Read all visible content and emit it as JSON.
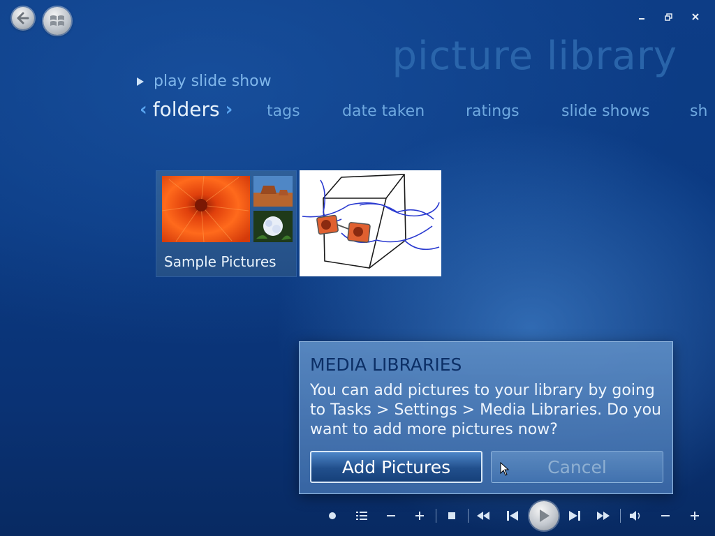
{
  "window": {
    "title": "picture library",
    "controls": {
      "minimize_icon": "minimize-icon",
      "restore_icon": "restore-icon",
      "close_icon": "close-icon"
    }
  },
  "nav": {
    "back_icon": "back-arrow-icon",
    "start_icon": "windows-orb-icon"
  },
  "actions": {
    "play_slide_show": "play slide show"
  },
  "pivot": {
    "current": "folders",
    "tabs": [
      "tags",
      "date taken",
      "ratings",
      "slide shows",
      "sh"
    ]
  },
  "tiles": [
    {
      "label": "Sample Pictures",
      "type": "folder"
    },
    {
      "label": "",
      "type": "picture"
    }
  ],
  "dialog": {
    "title": "MEDIA LIBRARIES",
    "message": "You can add pictures to your library by going to Tasks > Settings > Media Libraries. Do you want to add more pictures now?",
    "primary_button": "Add Pictures",
    "secondary_button": "Cancel"
  },
  "transport": {
    "buttons": [
      "record-icon",
      "guide-list-icon",
      "zoom-out-icon",
      "zoom-in-icon",
      "stop-icon",
      "rewind-icon",
      "previous-icon",
      "play-icon",
      "next-icon",
      "fast-forward-icon",
      "mute-icon",
      "volume-down-icon",
      "volume-up-icon"
    ]
  },
  "colors": {
    "background": "#0b3a82",
    "accent": "#5aa5f0",
    "dialog": "#4f82bf"
  }
}
